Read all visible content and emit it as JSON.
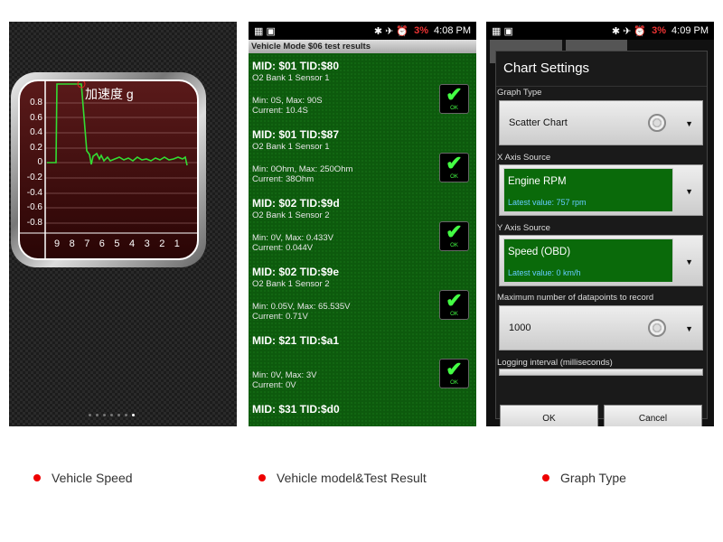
{
  "panel1": {
    "gauge_title": "加速度 g",
    "y_ticks": [
      "0.8",
      "0.6",
      "0.4",
      "0.2",
      "0",
      "-0.2",
      "-0.4",
      "-0.6",
      "-0.8"
    ],
    "x_ticks": [
      "9",
      "8",
      "7",
      "6",
      "5",
      "4",
      "3",
      "2",
      "1"
    ],
    "line_color": "#33dd33",
    "page_dots": 7,
    "active_dot": 6
  },
  "panel2": {
    "status_time": "4:08 PM",
    "battery": "3%",
    "title": "Vehicle Mode $06 test results",
    "ok_label": "OK",
    "rows": [
      {
        "mid": "MID: $01 TID:$80",
        "sensor": "O2 Bank 1 Sensor 1",
        "minmax": "Min: 0S, Max: 90S",
        "current": "Current: 10.4S"
      },
      {
        "mid": "MID: $01 TID:$87",
        "sensor": "O2 Bank 1 Sensor 1",
        "minmax": "Min: 0Ohm, Max: 250Ohm",
        "current": "Current: 38Ohm"
      },
      {
        "mid": "MID: $02 TID:$9d",
        "sensor": "O2 Bank 1 Sensor 2",
        "minmax": "Min: 0V, Max: 0.433V",
        "current": "Current: 0.044V"
      },
      {
        "mid": "MID: $02 TID:$9e",
        "sensor": "O2 Bank 1 Sensor 2",
        "minmax": "Min: 0.05V, Max: 65.535V",
        "current": "Current: 0.71V"
      },
      {
        "mid": "MID: $21 TID:$a1",
        "sensor": "",
        "minmax": "Min: 0V, Max: 3V",
        "current": "Current: 0V"
      },
      {
        "mid": "MID: $31 TID:$d0",
        "sensor": "",
        "minmax": "",
        "current": ""
      }
    ]
  },
  "panel3": {
    "status_time": "4:09 PM",
    "battery": "3%",
    "dialog_title": "Chart Settings",
    "graph_type_label": "Graph Type",
    "graph_type": "Scatter Chart",
    "x_label": "X Axis Source",
    "x_value": "Engine RPM",
    "x_latest": "Latest value: 757 rpm",
    "y_label": "Y Axis Source",
    "y_value": "Speed (OBD)",
    "y_latest": "Latest value: 0 km/h",
    "max_label": "Maximum number of datapoints to record",
    "max_value": "1000",
    "logging_label": "Logging interval (milliseconds)",
    "ok": "OK",
    "cancel": "Cancel"
  },
  "captions": [
    "Vehicle Speed",
    "Vehicle model&Test Result",
    "Graph Type"
  ]
}
